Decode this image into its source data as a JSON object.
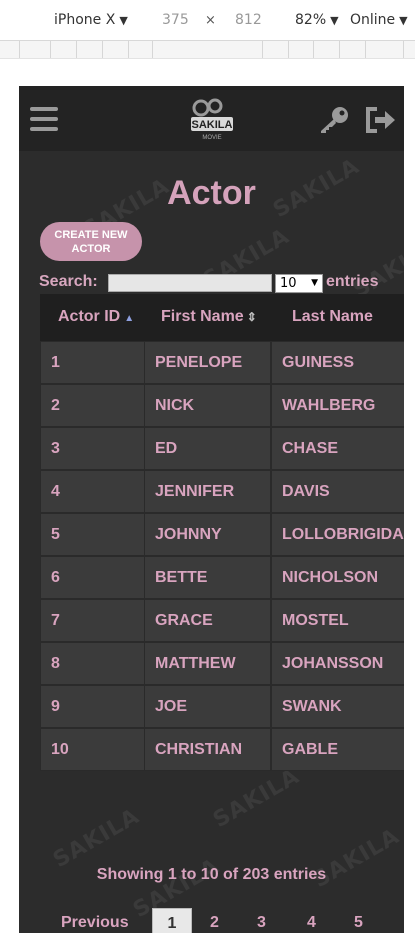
{
  "devtools": {
    "device": "iPhone X",
    "width": "375",
    "times": "×",
    "height": "812",
    "zoom": "82%",
    "network": "Online"
  },
  "header": {
    "logo_text": "SAKILA",
    "logo_sub": "MOVIE"
  },
  "watermark_text": "SAKILA",
  "page": {
    "title": "Actor",
    "create_button_line1": "CREATE NEW",
    "create_button_line2": "ACTOR"
  },
  "table_controls": {
    "search_label": "Search:",
    "search_value": "",
    "entries_value": "10",
    "entries_label": "entries"
  },
  "table": {
    "columns": [
      "Actor ID",
      "First Name",
      "Last Name"
    ],
    "rows": [
      [
        "1",
        "PENELOPE",
        "GUINESS"
      ],
      [
        "2",
        "NICK",
        "WAHLBERG"
      ],
      [
        "3",
        "ED",
        "CHASE"
      ],
      [
        "4",
        "JENNIFER",
        "DAVIS"
      ],
      [
        "5",
        "JOHNNY",
        "LOLLOBRIGIDA"
      ],
      [
        "6",
        "BETTE",
        "NICHOLSON"
      ],
      [
        "7",
        "GRACE",
        "MOSTEL"
      ],
      [
        "8",
        "MATTHEW",
        "JOHANSSON"
      ],
      [
        "9",
        "JOE",
        "SWANK"
      ],
      [
        "10",
        "CHRISTIAN",
        "GABLE"
      ]
    ]
  },
  "footer": {
    "info": "Showing 1 to 10 of 203 entries",
    "pagination": {
      "previous": "Previous",
      "pages": [
        "1",
        "2",
        "3",
        "4",
        "5"
      ],
      "current": "1"
    }
  },
  "colors": {
    "accent": "#d9a4bf",
    "background": "#2c2c2c",
    "header": "#232323",
    "cell": "#3b3b3b"
  }
}
